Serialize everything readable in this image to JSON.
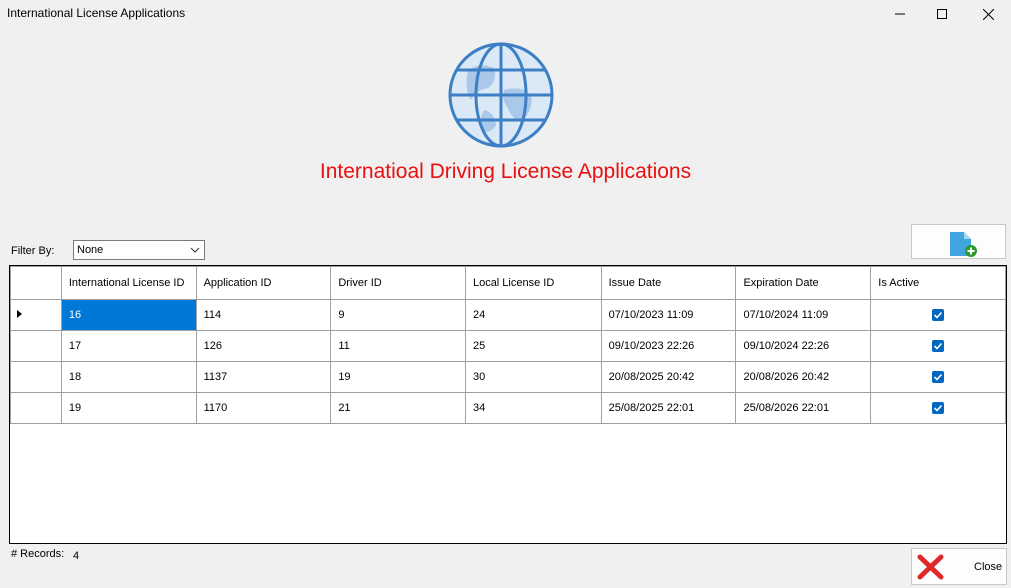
{
  "window": {
    "title": "International License Applications"
  },
  "header": {
    "title": "Internatioal Driving License Applications"
  },
  "filter": {
    "label": "Filter By:",
    "selected": "None"
  },
  "table": {
    "columns": [
      "International License ID",
      "Application ID",
      "Driver ID",
      "Local License ID",
      "Issue Date",
      "Expiration Date",
      "Is Active"
    ],
    "rows": [
      {
        "intl_id": "16",
        "app_id": "114",
        "driver_id": "9",
        "local_id": "24",
        "issue": "07/10/2023 11:09",
        "expire": "07/10/2024 11:09",
        "active": true
      },
      {
        "intl_id": "17",
        "app_id": "126",
        "driver_id": "11",
        "local_id": "25",
        "issue": "09/10/2023 22:26",
        "expire": "09/10/2024 22:26",
        "active": true
      },
      {
        "intl_id": "18",
        "app_id": "1137",
        "driver_id": "19",
        "local_id": "30",
        "issue": "20/08/2025 20:42",
        "expire": "20/08/2026 20:42",
        "active": true
      },
      {
        "intl_id": "19",
        "app_id": "1170",
        "driver_id": "21",
        "local_id": "34",
        "issue": "25/08/2025 22:01",
        "expire": "25/08/2026 22:01",
        "active": true
      }
    ]
  },
  "footer": {
    "records_label": "# Records:",
    "records_count": "4",
    "close_label": "Close"
  },
  "icons": {
    "header": "globe-icon",
    "add": "add-application-icon",
    "close": "red-x-icon"
  },
  "colors": {
    "heading": "#e81010",
    "selection": "#0078d7",
    "checkbox": "#0067c0"
  }
}
